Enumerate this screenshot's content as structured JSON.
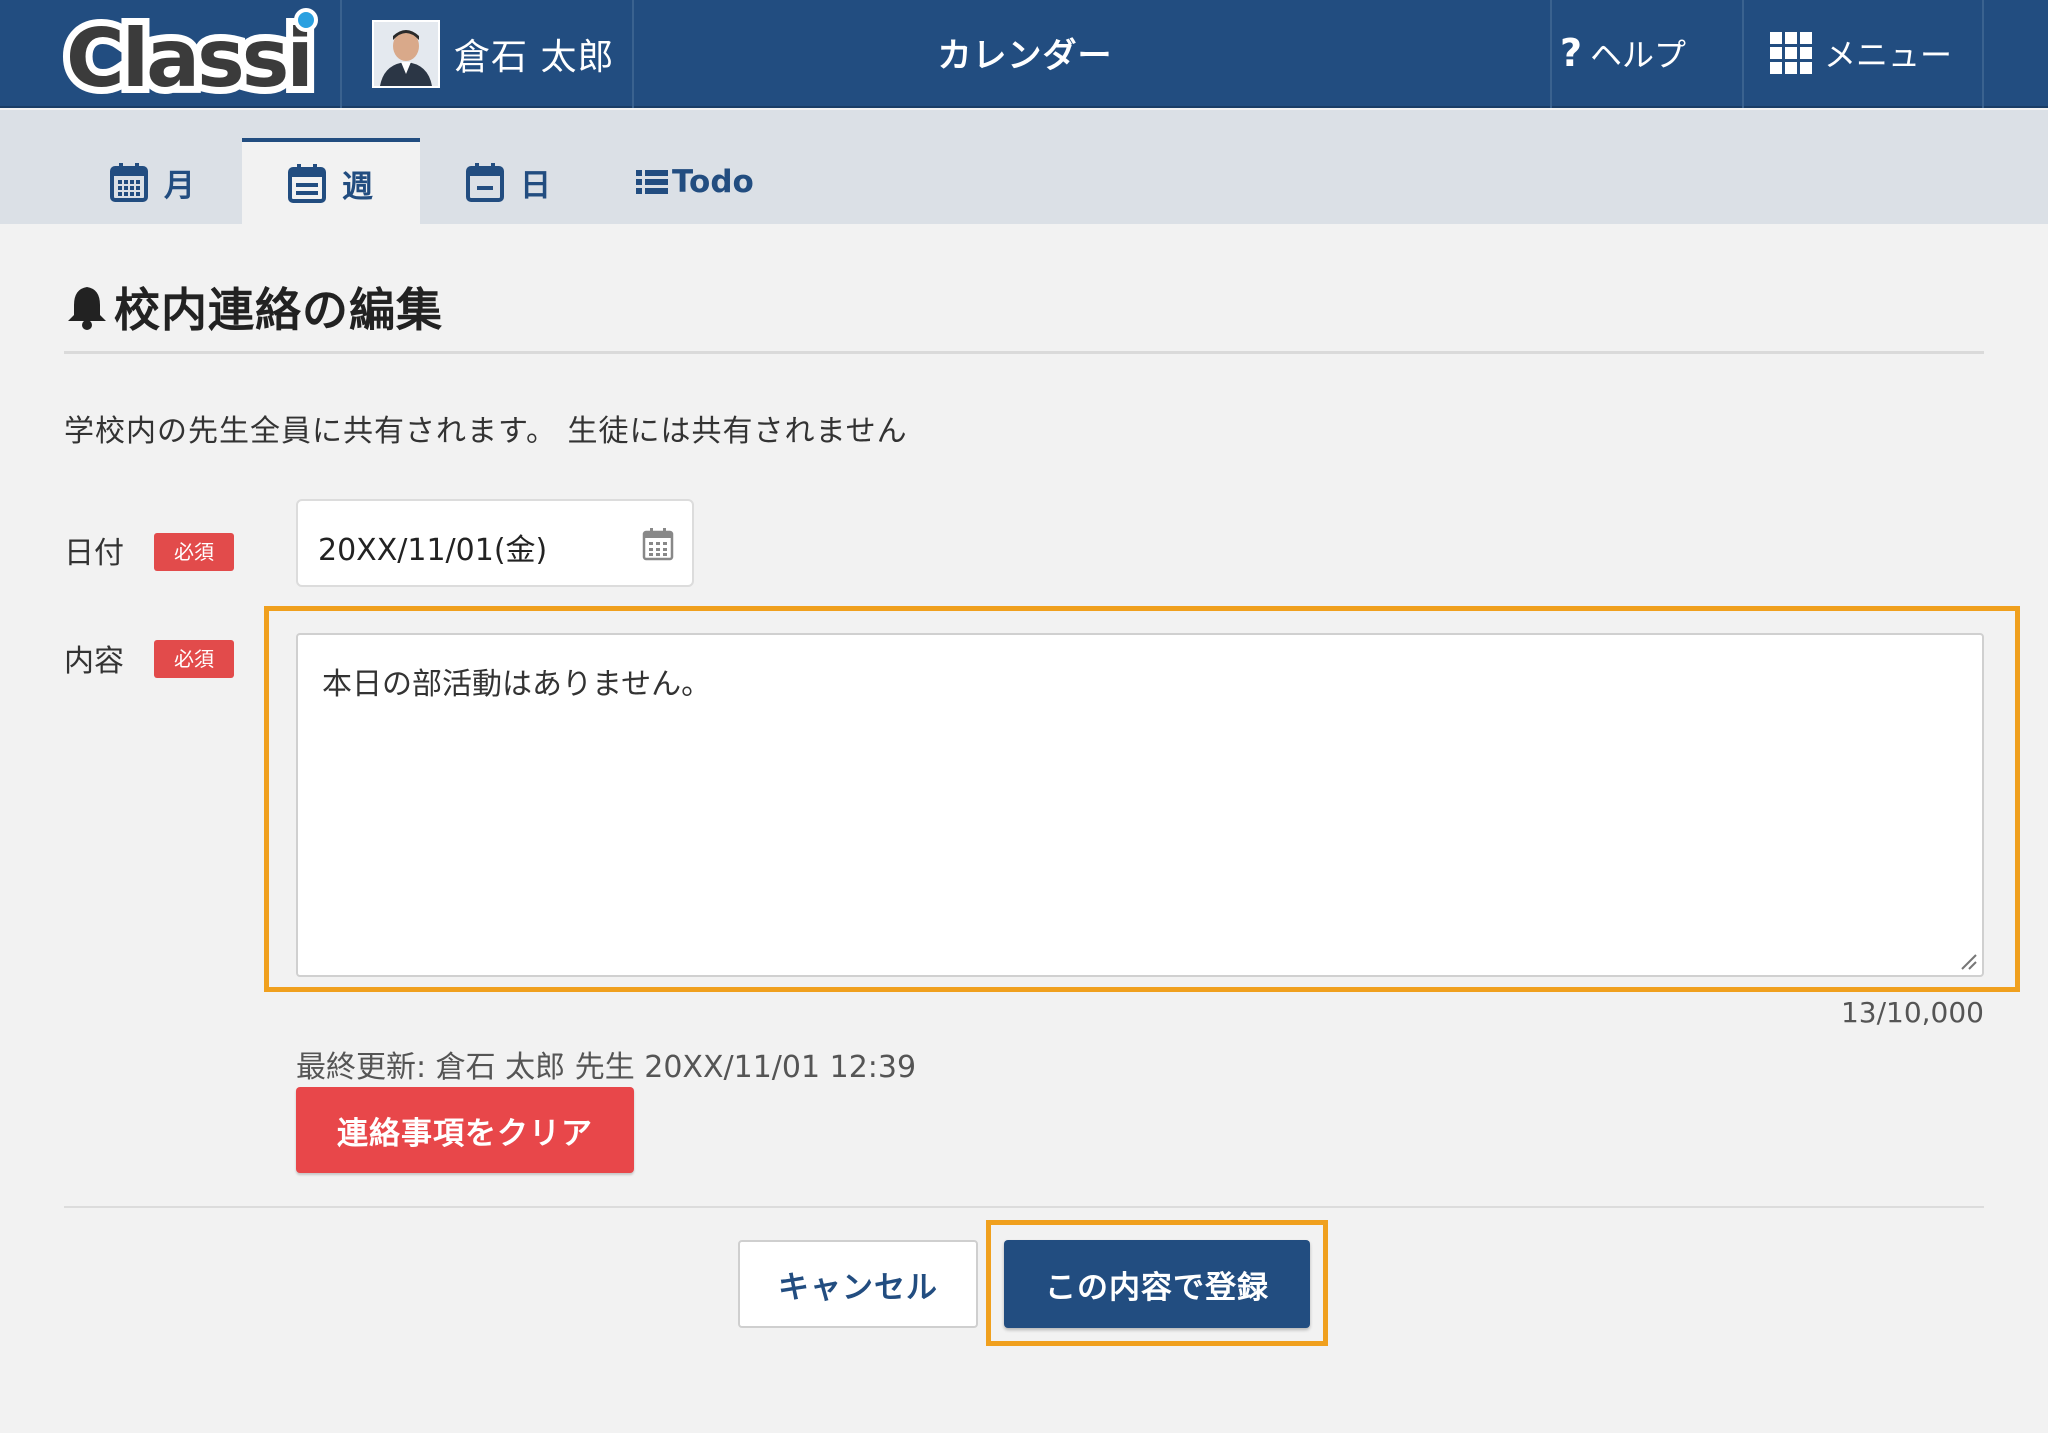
{
  "header": {
    "logo_text": "Classi",
    "user_name": "倉石 太郎",
    "page_title": "カレンダー",
    "help_icon_glyph": "?",
    "help_label": "ヘルプ",
    "menu_label": "メニュー",
    "background_color": "#224d80"
  },
  "tabs": [
    {
      "label": "月",
      "icon": "calendar-month-icon",
      "active": false
    },
    {
      "label": "週",
      "icon": "calendar-week-icon",
      "active": true
    },
    {
      "label": "日",
      "icon": "calendar-day-icon",
      "active": false
    },
    {
      "label": "Todo",
      "icon": "list-icon",
      "active": false
    }
  ],
  "section": {
    "title": "校内連絡の編集",
    "description": "学校内の先生全員に共有されます。 生徒には共有されません"
  },
  "form": {
    "date": {
      "label": "日付",
      "required_badge": "必須",
      "value": "20XX/11/01(金)"
    },
    "content": {
      "label": "内容",
      "required_badge": "必須",
      "value": "本日の部活動はありません。",
      "char_count": "13/10,000"
    },
    "last_update": "最終更新: 倉石 太郎 先生 20XX/11/01 12:39",
    "clear_button": "連絡事項をクリア"
  },
  "actions": {
    "cancel": "キャンセル",
    "submit": "この内容で登録"
  },
  "colors": {
    "primary": "#224d80",
    "danger": "#e8474a",
    "highlight": "#f0a01e"
  }
}
